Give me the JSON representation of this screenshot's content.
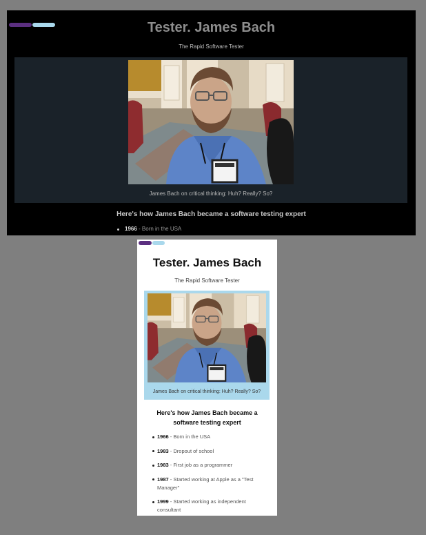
{
  "colors": {
    "pill_purple": "#5b2f80",
    "pill_blue": "#a9d8ec",
    "dark_bg": "#000000",
    "dark_figure_bg": "#1a2229",
    "light_figure_bg": "#aad8ec"
  },
  "site": {
    "title": "Tester. James Bach",
    "subtitle": "The Rapid Software Tester"
  },
  "figure": {
    "image_alt": "James Bach portrait photo",
    "caption": "James Bach on critical thinking: Huh? Really? So?"
  },
  "timeline": {
    "heading": "Here's how James Bach became a software testing expert",
    "items": [
      {
        "year": "1966",
        "text": " - Born in the USA"
      },
      {
        "year": "1983",
        "text": " - Dropout of school"
      },
      {
        "year": "1983",
        "text": " - First job as a programmer"
      },
      {
        "year": "1987",
        "text": " - Started working at Apple as a \"Test Manager\""
      },
      {
        "year": "1999",
        "text": " - Started working as independent consultant"
      }
    ]
  }
}
